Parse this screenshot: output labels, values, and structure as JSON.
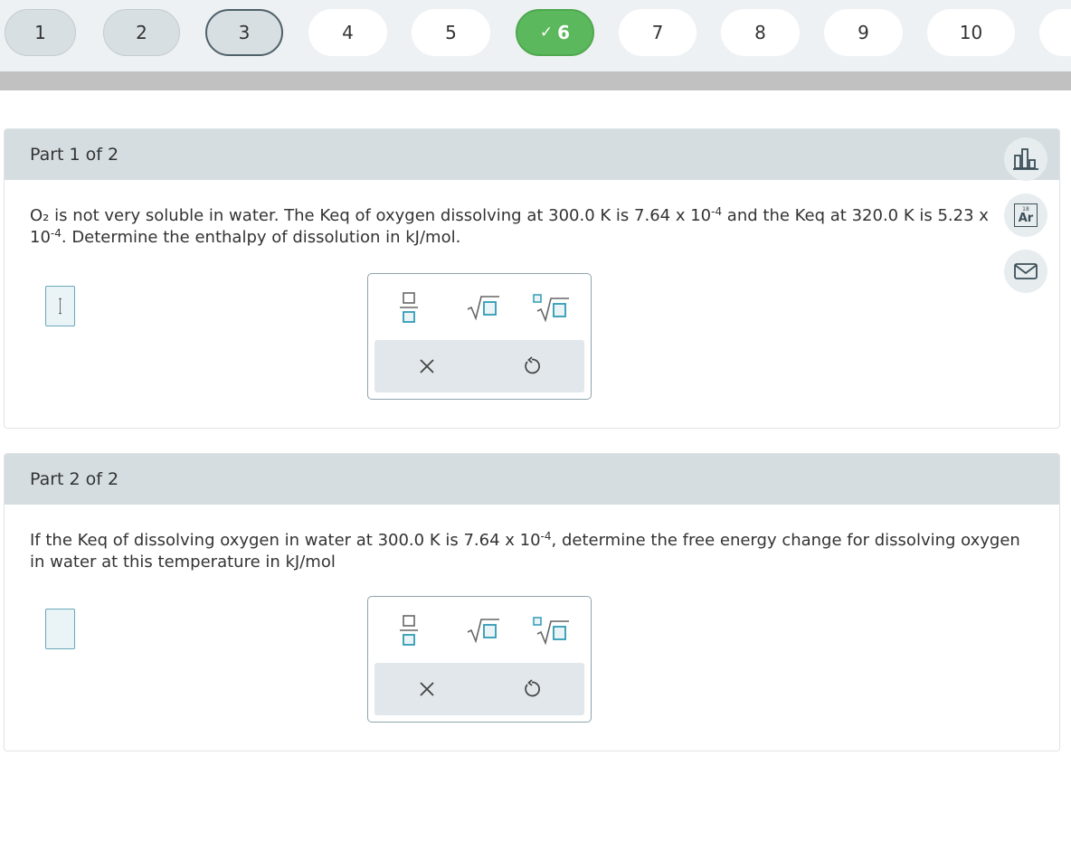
{
  "nav": {
    "questions": [
      {
        "label": "1",
        "state": "visited"
      },
      {
        "label": "2",
        "state": "visited"
      },
      {
        "label": "3",
        "state": "current"
      },
      {
        "label": "4",
        "state": "default"
      },
      {
        "label": "5",
        "state": "default"
      },
      {
        "label": "6",
        "state": "correct"
      },
      {
        "label": "7",
        "state": "default"
      },
      {
        "label": "8",
        "state": "default"
      },
      {
        "label": "9",
        "state": "default"
      },
      {
        "label": "10",
        "state": "default"
      }
    ],
    "check_glyph": "✓"
  },
  "parts": [
    {
      "title": "Part 1 of 2",
      "question": {
        "pre": "O₂ is not very soluble in water. The Keq of oxygen dissolving at 300.0 K is 7.64 x 10",
        "exp1": "-4",
        "mid": " and the Keq at 320.0 K is 5.23 x 10",
        "exp2": "-4",
        "post": ". Determine the enthalpy of dissolution in kJ/mol."
      },
      "answer_value": ""
    },
    {
      "title": "Part 2 of 2",
      "question": {
        "pre": "If the Keq of dissolving oxygen in water at 300.0 K is 7.64 x 10",
        "exp1": "-4",
        "post": ", determine the free energy change for dissolving oxygen in water at this temperature in kJ/mol"
      },
      "answer_value": ""
    }
  ],
  "palette_icons": [
    "fraction-icon",
    "square-root-icon",
    "nth-root-icon",
    "clear-icon",
    "undo-icon"
  ],
  "tools": {
    "periodic_table": {
      "number": "18",
      "symbol": "Ar"
    },
    "icons": [
      "bar-chart-icon",
      "periodic-table-icon",
      "mail-icon"
    ]
  },
  "colors": {
    "correct": "#5cb85c",
    "panel_header": "#d5dde1",
    "accent": "#2f9bb4",
    "progress_track": "#c1c1c1"
  }
}
